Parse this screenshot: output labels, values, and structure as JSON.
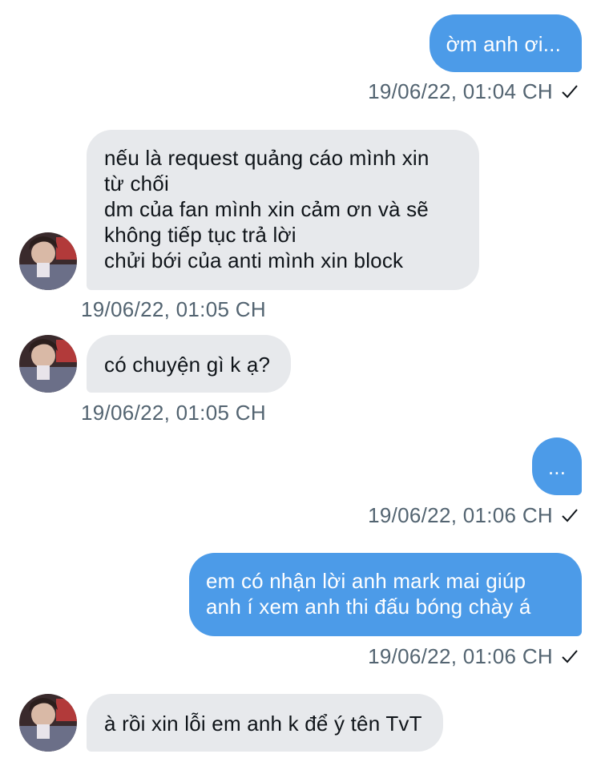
{
  "messages": [
    {
      "text": "ờm anh ơi...",
      "timestamp": "19/06/22, 01:04 CH"
    },
    {
      "text": "nếu là request quảng cáo mình xin\ntừ chối\ndm của fan mình xin cảm ơn và sẽ\nkhông tiếp tục trả lời\nchửi bới của anti mình xin block",
      "timestamp": "19/06/22, 01:05 CH"
    },
    {
      "text": "có chuyện gì k ạ?",
      "timestamp": "19/06/22, 01:05 CH"
    },
    {
      "text": "...",
      "timestamp": "19/06/22, 01:06 CH"
    },
    {
      "text": "em có nhận lời anh mark mai giúp\nanh í xem anh thi đấu bóng chày á",
      "timestamp": "19/06/22, 01:06 CH"
    },
    {
      "text": "à rồi xin lỗi em anh k để ý tên TvT",
      "timestamp": ""
    }
  ],
  "colors": {
    "outgoing_bubble": "#4c9be8",
    "incoming_bubble": "#e7e9ec",
    "timestamp": "#536471"
  },
  "icons": {
    "sent_status": "check-icon",
    "sender_photo": "avatar"
  }
}
